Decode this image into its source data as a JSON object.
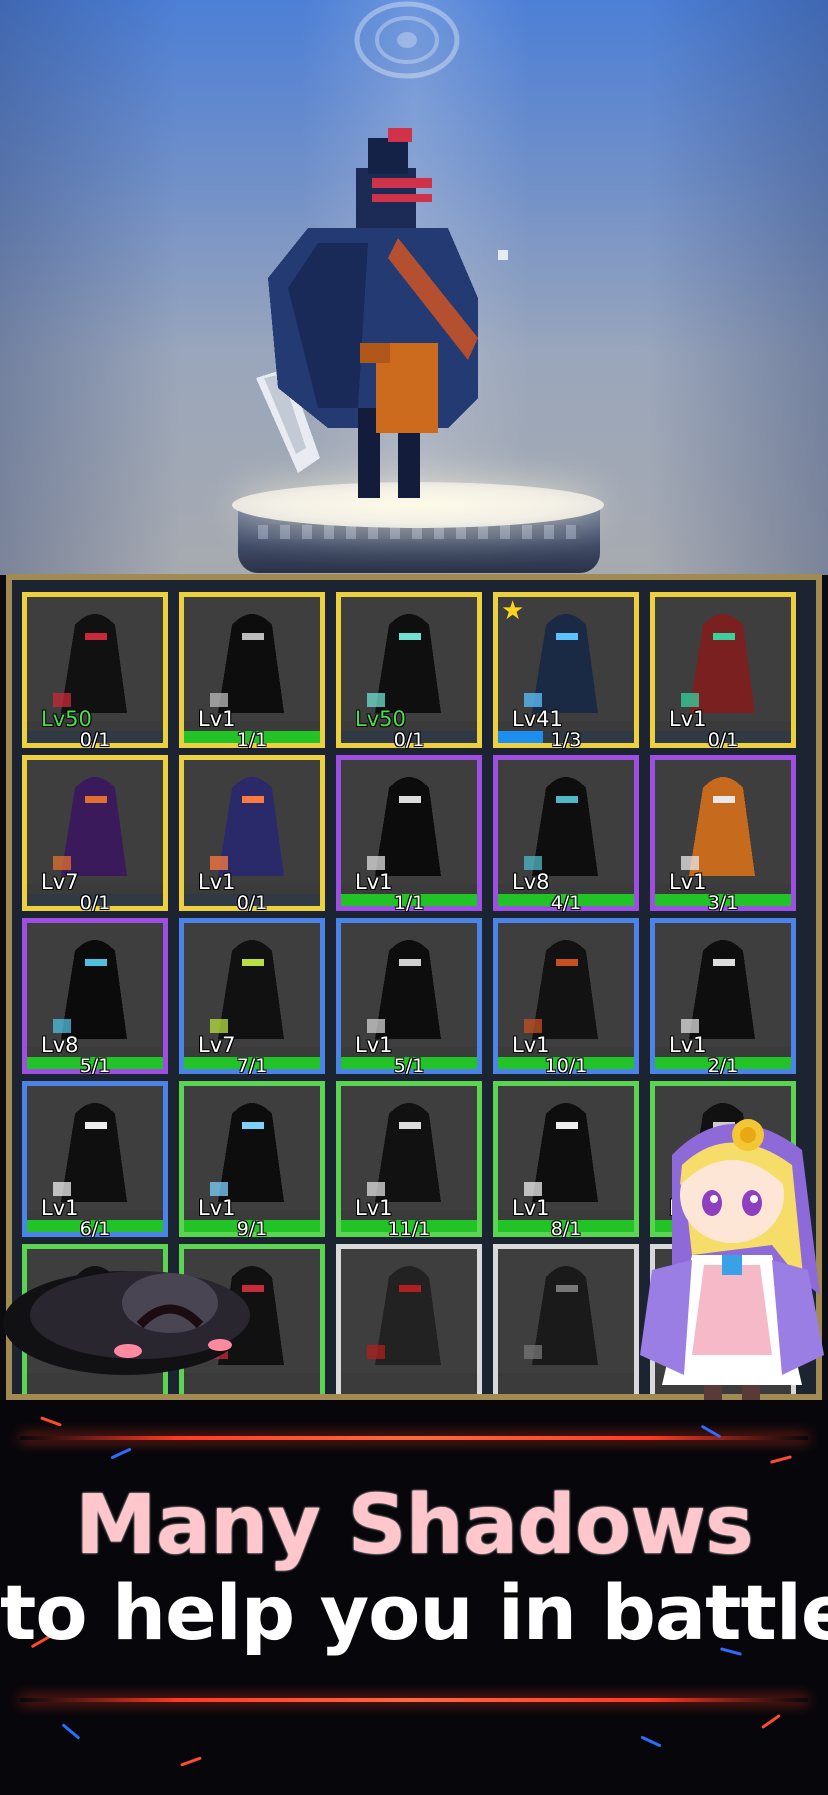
{
  "colors": {
    "gold_frame": "#ecd040",
    "purple_frame": "#9c4fe0",
    "blue_frame": "#4b84e6",
    "green_frame": "#5bd452",
    "white_frame": "#d9d9d9",
    "progress_green": "#21c326",
    "progress_blue": "#1c8ef0",
    "headline_pink": "#ffc6cc",
    "accent_red": "#ff3b22"
  },
  "preview": {
    "featured_shadow": "shadow-knight-sprite"
  },
  "collection": {
    "cards": [
      {
        "rarity": "gold",
        "level": "Lv50",
        "count": "0/1",
        "progress": 0,
        "level_color": "green"
      },
      {
        "rarity": "gold",
        "level": "Lv1",
        "count": "1/1",
        "progress": 1
      },
      {
        "rarity": "gold",
        "level": "Lv50",
        "count": "0/1",
        "progress": 0,
        "level_color": "green"
      },
      {
        "rarity": "gold",
        "level": "Lv41",
        "count": "1/3",
        "progress": 0.33,
        "starred": true
      },
      {
        "rarity": "gold",
        "level": "Lv1",
        "count": "0/1",
        "progress": 0
      },
      {
        "rarity": "gold",
        "level": "Lv7",
        "count": "0/1",
        "progress": 0
      },
      {
        "rarity": "gold",
        "level": "Lv1",
        "count": "0/1",
        "progress": 0
      },
      {
        "rarity": "purple",
        "level": "Lv1",
        "count": "1/1",
        "progress": 1
      },
      {
        "rarity": "purple",
        "level": "Lv8",
        "count": "4/1",
        "progress": 1
      },
      {
        "rarity": "purple",
        "level": "Lv1",
        "count": "3/1",
        "progress": 1
      },
      {
        "rarity": "purple",
        "level": "Lv8",
        "count": "5/1",
        "progress": 1
      },
      {
        "rarity": "blue",
        "level": "Lv7",
        "count": "7/1",
        "progress": 1
      },
      {
        "rarity": "blue",
        "level": "Lv1",
        "count": "5/1",
        "progress": 1
      },
      {
        "rarity": "blue",
        "level": "Lv1",
        "count": "10/1",
        "progress": 1
      },
      {
        "rarity": "blue",
        "level": "Lv1",
        "count": "2/1",
        "progress": 1
      },
      {
        "rarity": "blue",
        "level": "Lv1",
        "count": "6/1",
        "progress": 1
      },
      {
        "rarity": "green",
        "level": "Lv1",
        "count": "9/1",
        "progress": 1
      },
      {
        "rarity": "green",
        "level": "Lv1",
        "count": "11/1",
        "progress": 1
      },
      {
        "rarity": "green",
        "level": "Lv1",
        "count": "8/1",
        "progress": 1
      },
      {
        "rarity": "green",
        "level": "Lv",
        "count": "",
        "progress": 1
      },
      {
        "rarity": "green",
        "level": "",
        "count": "",
        "progress": null
      },
      {
        "rarity": "green",
        "level": "",
        "count": "",
        "progress": null
      },
      {
        "rarity": "white",
        "level": "",
        "count": "",
        "progress": null
      },
      {
        "rarity": "white",
        "level": "",
        "count": "",
        "progress": null
      },
      {
        "rarity": "white",
        "level": "",
        "count": "",
        "progress": null
      }
    ]
  },
  "banner": {
    "line1": "Many Shadows",
    "line2": "to help you in battle"
  }
}
